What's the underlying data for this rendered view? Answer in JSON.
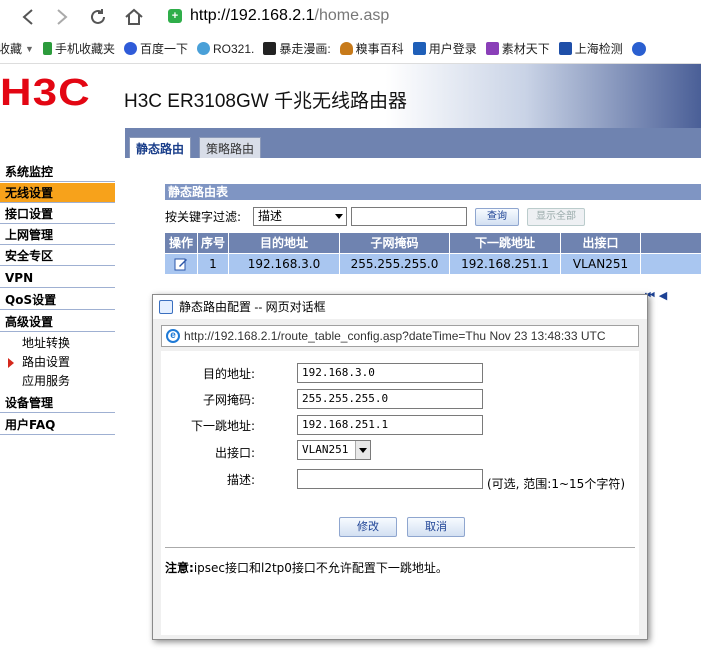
{
  "browser": {
    "url_host": "http://192.168.2.1",
    "url_path": "/home.asp",
    "bookmarks": [
      {
        "label": "收藏",
        "color": "#f2b600"
      },
      {
        "label": "手机收藏夹",
        "color": "#2c9b3c"
      },
      {
        "label": "百度一下",
        "color": "#2f5bd8"
      },
      {
        "label": "RO321.",
        "color": "#4aa0d8"
      },
      {
        "label": "暴走漫画:",
        "color": "#222222"
      },
      {
        "label": "糗事百科",
        "color": "#c77a1a"
      },
      {
        "label": "用户登录",
        "color": "#1f5fb8"
      },
      {
        "label": "素材天下",
        "color": "#8a3fb8"
      },
      {
        "label": "上海检测",
        "color": "#1f4fa8"
      }
    ]
  },
  "header": {
    "logo": "H3C",
    "product": "H3C ER3108GW 千兆无线路由器"
  },
  "sidebar": {
    "items": [
      {
        "label": "系统监控"
      },
      {
        "label": "无线设置"
      },
      {
        "label": "接口设置"
      },
      {
        "label": "上网管理"
      },
      {
        "label": "安全专区"
      },
      {
        "label": "VPN"
      },
      {
        "label": "QoS设置"
      },
      {
        "label": "高级设置"
      }
    ],
    "sub_items": [
      {
        "label": "地址转换"
      },
      {
        "label": "路由设置"
      },
      {
        "label": "应用服务"
      }
    ],
    "bottom_items": [
      {
        "label": "设备管理"
      },
      {
        "label": "用户FAQ"
      }
    ]
  },
  "tabs": [
    {
      "label": "静态路由"
    },
    {
      "label": "策略路由"
    }
  ],
  "route_table": {
    "title": "静态路由表",
    "filter_label": "按关键字过滤:",
    "filter_select": "描述",
    "query_button": "查询",
    "show_all_button": "显示全部",
    "columns": [
      "操作",
      "序号",
      "目的地址",
      "子网掩码",
      "下一跳地址",
      "出接口"
    ],
    "rows": [
      {
        "index": "1",
        "dest": "192.168.3.0",
        "mask": "255.255.255.0",
        "next_hop": "192.168.251.1",
        "iface": "VLAN251"
      }
    ]
  },
  "dialog": {
    "title": "静态路由配置 -- 网页对话框",
    "url": "http://192.168.2.1/route_table_config.asp?dateTime=Thu Nov 23 13:48:33 UTC",
    "fields": {
      "dest_label": "目的地址:",
      "dest_value": "192.168.3.0",
      "mask_label": "子网掩码:",
      "mask_value": "255.255.255.0",
      "next_hop_label": "下一跳地址:",
      "next_hop_value": "192.168.251.1",
      "iface_label": "出接口:",
      "iface_value": "VLAN251",
      "desc_label": "描述:",
      "desc_value": "",
      "desc_hint": "(可选, 范围:1~15个字符)"
    },
    "modify_button": "修改",
    "cancel_button": "取消",
    "note_label": "注意:",
    "note_text": "ipsec接口和l2tp0接口不允许配置下一跳地址。"
  }
}
